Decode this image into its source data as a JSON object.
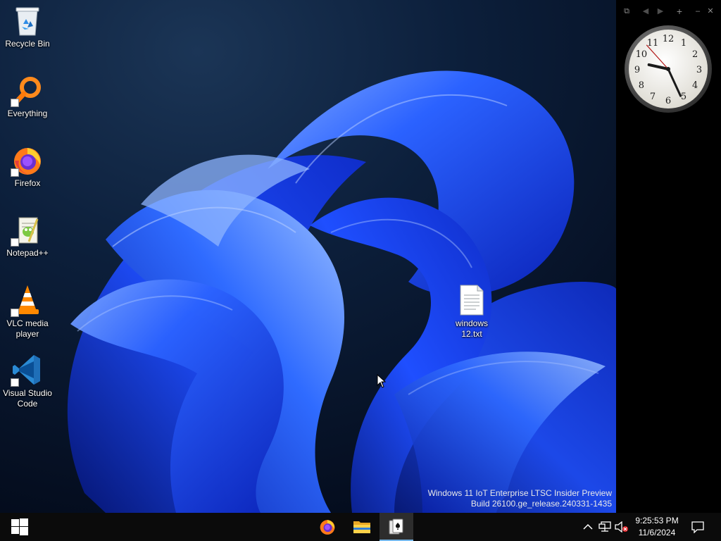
{
  "desktop": {
    "icons": [
      {
        "label": "Recycle Bin",
        "icon": "recycle-bin-icon",
        "shortcut": false
      },
      {
        "label": "Everything",
        "icon": "everything-search-icon",
        "shortcut": true
      },
      {
        "label": "Firefox",
        "icon": "firefox-icon",
        "shortcut": true
      },
      {
        "label": "Notepad++",
        "icon": "notepadpp-icon",
        "shortcut": true
      },
      {
        "label": "VLC media player",
        "icon": "vlc-icon",
        "shortcut": true
      },
      {
        "label": "Visual Studio Code",
        "icon": "vscode-icon",
        "shortcut": true
      }
    ],
    "file": {
      "label": "windows 12.txt",
      "icon": "text-file-icon"
    }
  },
  "watermark": {
    "line1": "Windows 11 IoT Enterprise LTSC Insider Preview",
    "line2": "Build 26100.ge_release.240331-1435"
  },
  "gadget": {
    "controls": [
      "restore-icon",
      "prev-icon",
      "next-icon",
      "add-icon",
      "minimize-icon",
      "close-icon"
    ],
    "clock": {
      "numerals": [
        "12",
        "1",
        "2",
        "3",
        "4",
        "5",
        "6",
        "7",
        "8",
        "9",
        "10",
        "11"
      ],
      "hour": 9,
      "minute": 25,
      "second": 53
    }
  },
  "taskbar": {
    "start": "windows-logo-icon",
    "pinned": [
      {
        "name": "firefox",
        "icon": "firefox-icon",
        "active": false
      },
      {
        "name": "file-explorer",
        "icon": "folder-icon",
        "active": false
      },
      {
        "name": "solitaire",
        "icon": "cards-icon",
        "active": true
      }
    ],
    "tray": {
      "icons": [
        "chevron-up-icon",
        "network-icon",
        "volume-muted-icon"
      ],
      "time": "9:25:53 PM",
      "date": "11/6/2024",
      "notification": "action-center-icon"
    }
  },
  "colors": {
    "taskbar": "#0b0b0b",
    "accent": "#76b9ed",
    "wallpaper_blue": "#1a4fff",
    "gadget_bg": "#000000"
  }
}
